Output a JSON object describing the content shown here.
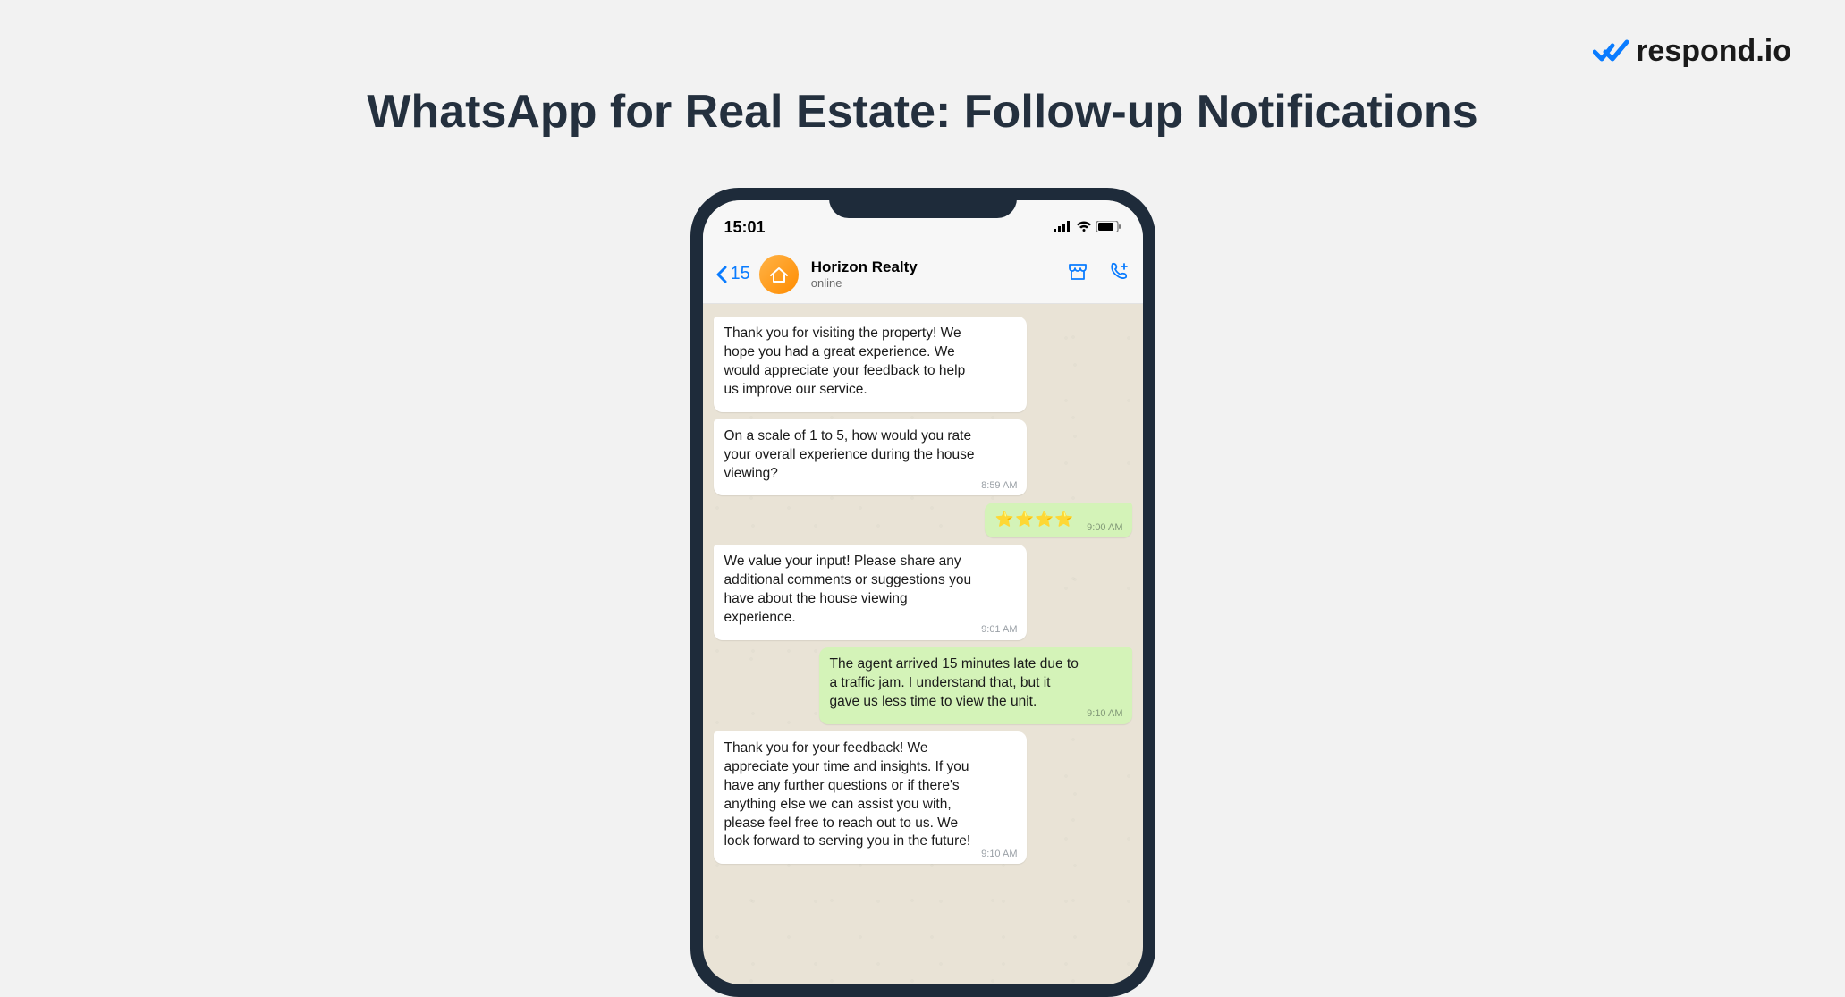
{
  "page_title": "WhatsApp for Real Estate: Follow-up Notifications",
  "brand": {
    "name": "respond.io"
  },
  "phone": {
    "status_bar": {
      "time": "15:01"
    },
    "chat_header": {
      "back_count": "15",
      "contact_name": "Horizon Realty",
      "status": "online"
    },
    "messages": [
      {
        "side": "in",
        "text": "Thank you for visiting the property!\nWe hope you had a great experience.\nWe would appreciate your feedback to help us improve our service.",
        "time": ""
      },
      {
        "side": "in",
        "text": "On a scale of 1 to 5, how would you rate your overall experience during the house viewing?",
        "time": "8:59 AM"
      },
      {
        "side": "out",
        "text": "⭐⭐⭐⭐",
        "time": "9:00 AM",
        "short": true
      },
      {
        "side": "in",
        "text": "We value your input! Please share any additional comments or suggestions you have about the house viewing experience.",
        "time": "9:01 AM"
      },
      {
        "side": "out",
        "text": "The agent arrived 15 minutes late due to a traffic jam. I understand that, but it gave us less time to view the unit.",
        "time": "9:10 AM"
      },
      {
        "side": "in",
        "text": "Thank you for your feedback! We appreciate your time and insights. If you have any further questions or if there's anything else we can assist you with, please feel free to reach out to us. We look forward to serving you in the future!",
        "time": "9:10 AM"
      }
    ]
  }
}
